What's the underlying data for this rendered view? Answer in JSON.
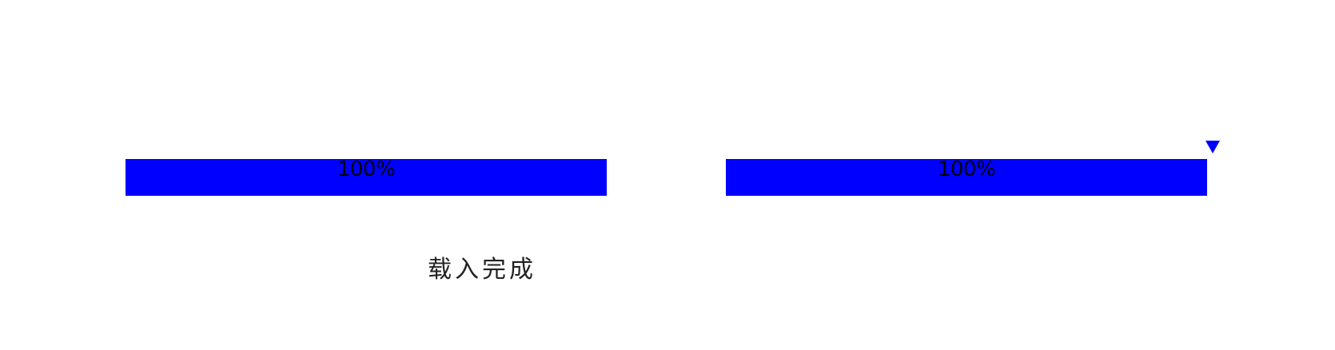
{
  "progress_bars": [
    {
      "label": "100%",
      "value_percent": 100
    },
    {
      "label": "100%",
      "value_percent": 100
    }
  ],
  "status": {
    "text": "载入完成"
  },
  "marker_icon": "triangle-down-icon",
  "colors": {
    "fill": "#0000ff",
    "background": "#ffffff",
    "text": "#000000"
  }
}
